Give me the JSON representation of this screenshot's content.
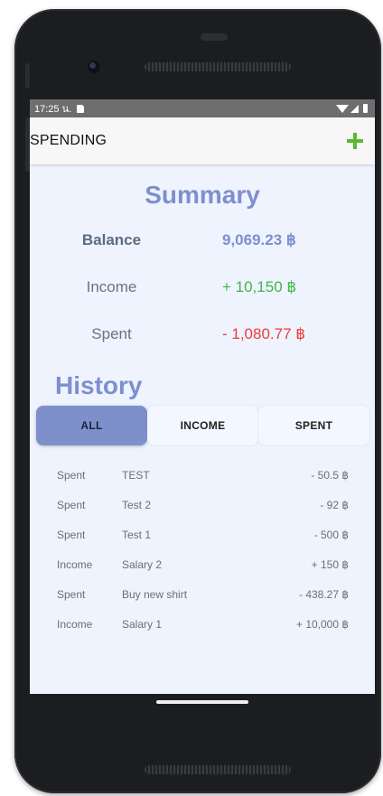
{
  "status_bar": {
    "time": "17:25 น."
  },
  "app_bar": {
    "title": "SPENDING",
    "add_icon": "plus-icon"
  },
  "summary": {
    "title": "Summary",
    "balance_label": "Balance",
    "balance_value": "9,069.23 ฿",
    "income_label": "Income",
    "income_value": "+ 10,150 ฿",
    "spent_label": "Spent",
    "spent_value": "- 1,080.77 ฿"
  },
  "history": {
    "title": "History",
    "tabs": [
      {
        "label": "ALL",
        "active": true
      },
      {
        "label": "INCOME",
        "active": false
      },
      {
        "label": "SPENT",
        "active": false
      }
    ],
    "items": [
      {
        "type": "Spent",
        "description": "TEST",
        "amount": "- 50.5 ฿"
      },
      {
        "type": "Spent",
        "description": "Test 2",
        "amount": "- 92 ฿"
      },
      {
        "type": "Spent",
        "description": "Test 1",
        "amount": "- 500 ฿"
      },
      {
        "type": "Income",
        "description": "Salary 2",
        "amount": "+ 150 ฿"
      },
      {
        "type": "Spent",
        "description": "Buy new shirt",
        "amount": "- 438.27 ฿"
      },
      {
        "type": "Income",
        "description": "Salary 1",
        "amount": "+ 10,000 ฿"
      }
    ]
  },
  "colors": {
    "accent": "#7e8fcf",
    "income": "#44b54a",
    "spent": "#ef3b3b",
    "add_button": "#5cb82e",
    "screen_bg": "#eef3fe"
  }
}
